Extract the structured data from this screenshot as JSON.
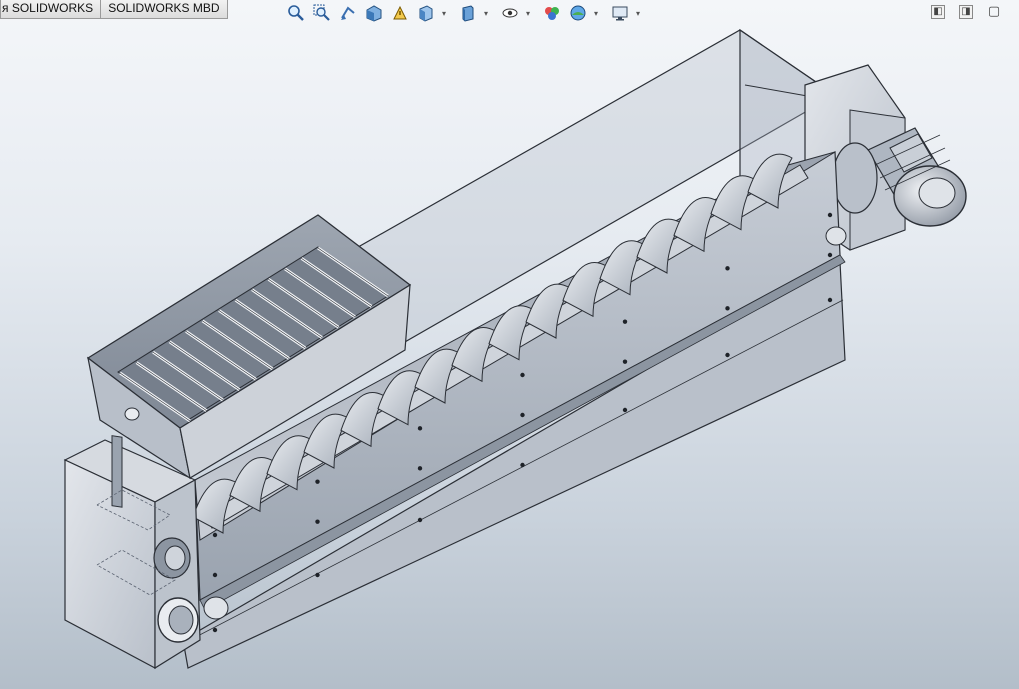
{
  "tabs": [
    {
      "label": "я SOLIDWORKS"
    },
    {
      "label": "SOLIDWORKS MBD"
    }
  ],
  "heads_up_toolbar": [
    {
      "icon": "zoom-to-fit-icon"
    },
    {
      "icon": "zoom-to-area-icon"
    },
    {
      "icon": "previous-view-icon"
    },
    {
      "icon": "section-view-icon"
    },
    {
      "icon": "dynamic-annotation-icon"
    },
    {
      "icon": "view-orientation-icon"
    },
    {
      "icon": "display-style-icon"
    },
    {
      "icon": "hide-show-items-icon"
    },
    {
      "icon": "edit-appearance-icon"
    },
    {
      "icon": "apply-scene-icon"
    },
    {
      "icon": "view-settings-icon"
    }
  ],
  "window_controls": [
    {
      "icon": "panel-left-icon",
      "glyph": "◧"
    },
    {
      "icon": "panel-right-icon",
      "glyph": "◨"
    },
    {
      "icon": "restore-icon",
      "glyph": "▢"
    }
  ],
  "model": {
    "screw_flights": 16,
    "grid_bars": 13,
    "colors": {
      "metal_light": "#d9dde3",
      "metal_mid": "#b4bbc5",
      "metal_dark": "#8d95a1",
      "edge": "#2b2f36",
      "glass": "#a9b2bf"
    }
  }
}
